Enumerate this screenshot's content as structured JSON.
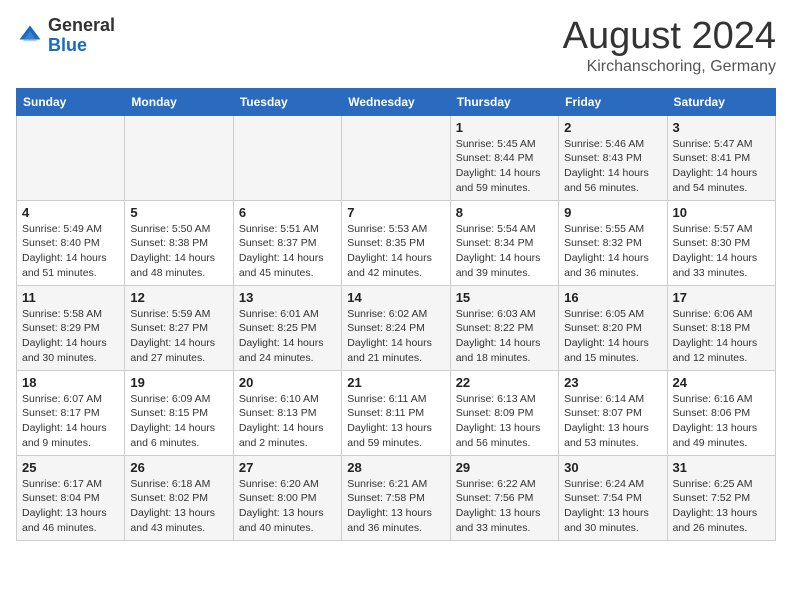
{
  "header": {
    "logo_line1": "General",
    "logo_line2": "Blue",
    "month_year": "August 2024",
    "location": "Kirchanschoring, Germany"
  },
  "weekdays": [
    "Sunday",
    "Monday",
    "Tuesday",
    "Wednesday",
    "Thursday",
    "Friday",
    "Saturday"
  ],
  "weeks": [
    [
      {
        "day": "",
        "info": ""
      },
      {
        "day": "",
        "info": ""
      },
      {
        "day": "",
        "info": ""
      },
      {
        "day": "",
        "info": ""
      },
      {
        "day": "1",
        "info": "Sunrise: 5:45 AM\nSunset: 8:44 PM\nDaylight: 14 hours\nand 59 minutes."
      },
      {
        "day": "2",
        "info": "Sunrise: 5:46 AM\nSunset: 8:43 PM\nDaylight: 14 hours\nand 56 minutes."
      },
      {
        "day": "3",
        "info": "Sunrise: 5:47 AM\nSunset: 8:41 PM\nDaylight: 14 hours\nand 54 minutes."
      }
    ],
    [
      {
        "day": "4",
        "info": "Sunrise: 5:49 AM\nSunset: 8:40 PM\nDaylight: 14 hours\nand 51 minutes."
      },
      {
        "day": "5",
        "info": "Sunrise: 5:50 AM\nSunset: 8:38 PM\nDaylight: 14 hours\nand 48 minutes."
      },
      {
        "day": "6",
        "info": "Sunrise: 5:51 AM\nSunset: 8:37 PM\nDaylight: 14 hours\nand 45 minutes."
      },
      {
        "day": "7",
        "info": "Sunrise: 5:53 AM\nSunset: 8:35 PM\nDaylight: 14 hours\nand 42 minutes."
      },
      {
        "day": "8",
        "info": "Sunrise: 5:54 AM\nSunset: 8:34 PM\nDaylight: 14 hours\nand 39 minutes."
      },
      {
        "day": "9",
        "info": "Sunrise: 5:55 AM\nSunset: 8:32 PM\nDaylight: 14 hours\nand 36 minutes."
      },
      {
        "day": "10",
        "info": "Sunrise: 5:57 AM\nSunset: 8:30 PM\nDaylight: 14 hours\nand 33 minutes."
      }
    ],
    [
      {
        "day": "11",
        "info": "Sunrise: 5:58 AM\nSunset: 8:29 PM\nDaylight: 14 hours\nand 30 minutes."
      },
      {
        "day": "12",
        "info": "Sunrise: 5:59 AM\nSunset: 8:27 PM\nDaylight: 14 hours\nand 27 minutes."
      },
      {
        "day": "13",
        "info": "Sunrise: 6:01 AM\nSunset: 8:25 PM\nDaylight: 14 hours\nand 24 minutes."
      },
      {
        "day": "14",
        "info": "Sunrise: 6:02 AM\nSunset: 8:24 PM\nDaylight: 14 hours\nand 21 minutes."
      },
      {
        "day": "15",
        "info": "Sunrise: 6:03 AM\nSunset: 8:22 PM\nDaylight: 14 hours\nand 18 minutes."
      },
      {
        "day": "16",
        "info": "Sunrise: 6:05 AM\nSunset: 8:20 PM\nDaylight: 14 hours\nand 15 minutes."
      },
      {
        "day": "17",
        "info": "Sunrise: 6:06 AM\nSunset: 8:18 PM\nDaylight: 14 hours\nand 12 minutes."
      }
    ],
    [
      {
        "day": "18",
        "info": "Sunrise: 6:07 AM\nSunset: 8:17 PM\nDaylight: 14 hours\nand 9 minutes."
      },
      {
        "day": "19",
        "info": "Sunrise: 6:09 AM\nSunset: 8:15 PM\nDaylight: 14 hours\nand 6 minutes."
      },
      {
        "day": "20",
        "info": "Sunrise: 6:10 AM\nSunset: 8:13 PM\nDaylight: 14 hours\nand 2 minutes."
      },
      {
        "day": "21",
        "info": "Sunrise: 6:11 AM\nSunset: 8:11 PM\nDaylight: 13 hours\nand 59 minutes."
      },
      {
        "day": "22",
        "info": "Sunrise: 6:13 AM\nSunset: 8:09 PM\nDaylight: 13 hours\nand 56 minutes."
      },
      {
        "day": "23",
        "info": "Sunrise: 6:14 AM\nSunset: 8:07 PM\nDaylight: 13 hours\nand 53 minutes."
      },
      {
        "day": "24",
        "info": "Sunrise: 6:16 AM\nSunset: 8:06 PM\nDaylight: 13 hours\nand 49 minutes."
      }
    ],
    [
      {
        "day": "25",
        "info": "Sunrise: 6:17 AM\nSunset: 8:04 PM\nDaylight: 13 hours\nand 46 minutes."
      },
      {
        "day": "26",
        "info": "Sunrise: 6:18 AM\nSunset: 8:02 PM\nDaylight: 13 hours\nand 43 minutes."
      },
      {
        "day": "27",
        "info": "Sunrise: 6:20 AM\nSunset: 8:00 PM\nDaylight: 13 hours\nand 40 minutes."
      },
      {
        "day": "28",
        "info": "Sunrise: 6:21 AM\nSunset: 7:58 PM\nDaylight: 13 hours\nand 36 minutes."
      },
      {
        "day": "29",
        "info": "Sunrise: 6:22 AM\nSunset: 7:56 PM\nDaylight: 13 hours\nand 33 minutes."
      },
      {
        "day": "30",
        "info": "Sunrise: 6:24 AM\nSunset: 7:54 PM\nDaylight: 13 hours\nand 30 minutes."
      },
      {
        "day": "31",
        "info": "Sunrise: 6:25 AM\nSunset: 7:52 PM\nDaylight: 13 hours\nand 26 minutes."
      }
    ]
  ]
}
